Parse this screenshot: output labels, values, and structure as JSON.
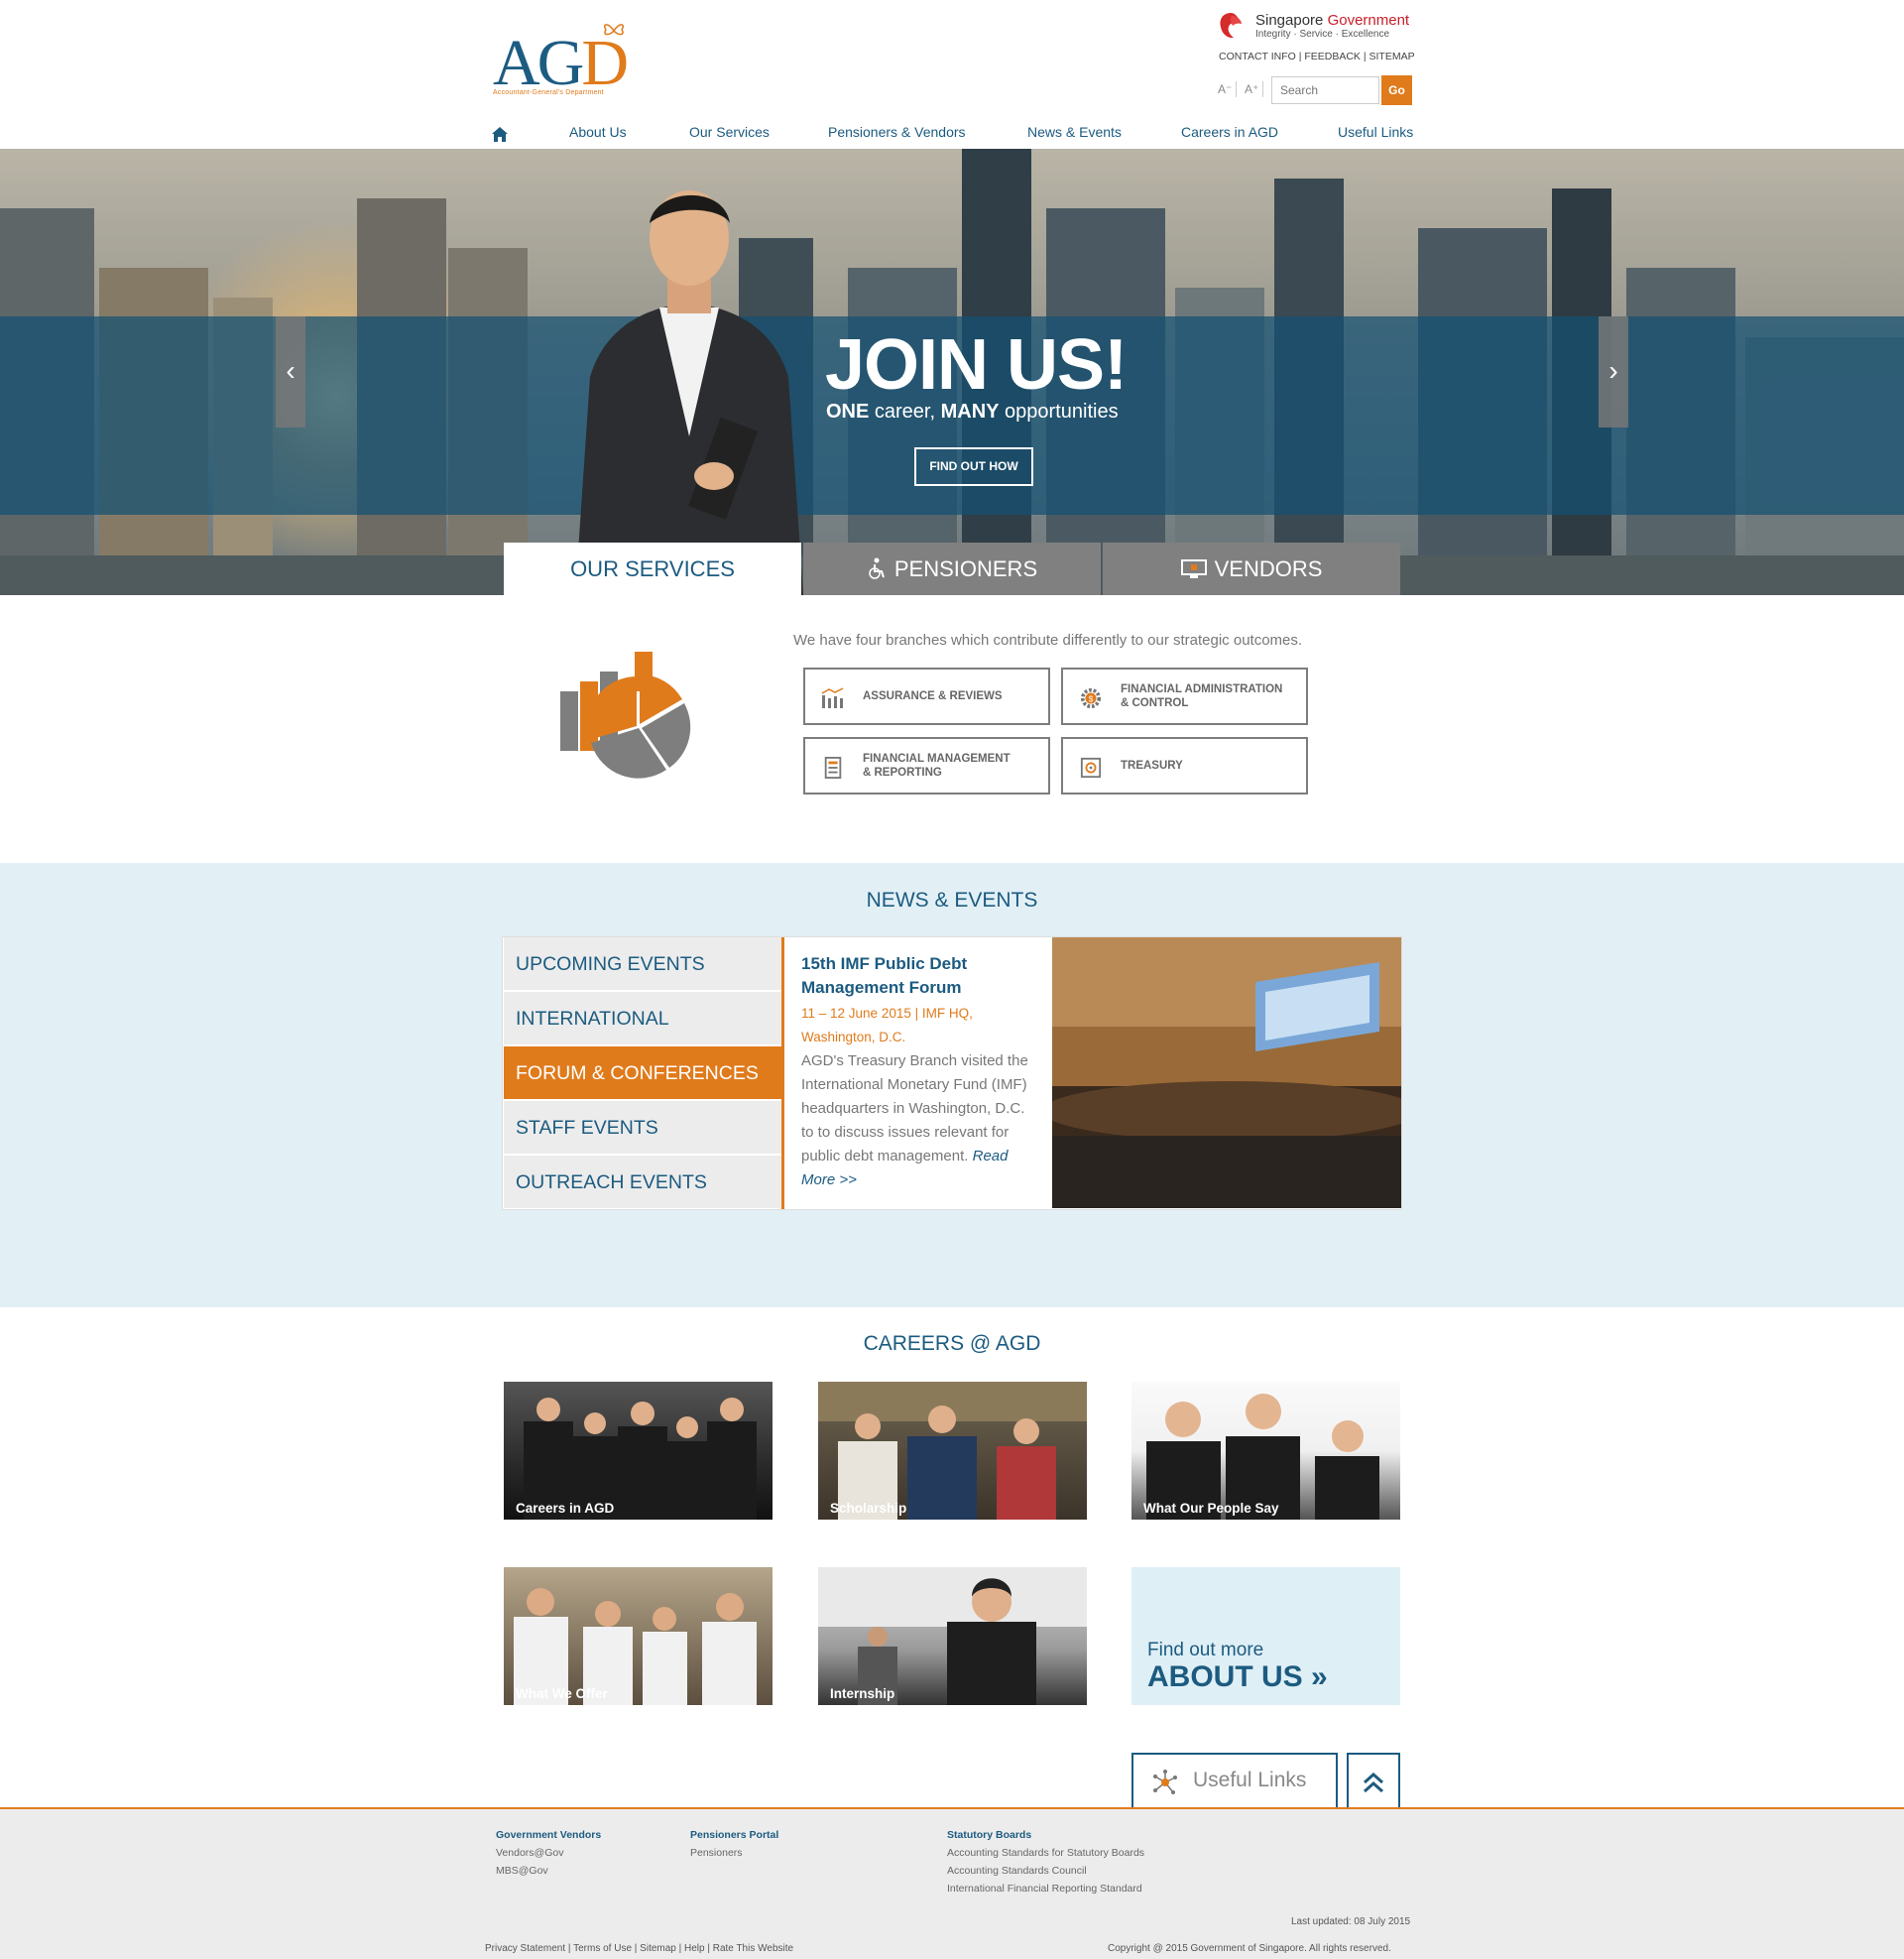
{
  "header": {
    "logo_letters_a": "AG",
    "logo_letters_d": "D",
    "logo_subtitle": "Accountant-General's Department",
    "sg_gov_name_a": "Singapore ",
    "sg_gov_name_b": "Government",
    "sg_gov_tagline": "Integrity · Service · Excellence",
    "utility_links": [
      "CONTACT INFO",
      "FEEDBACK",
      "SITEMAP"
    ],
    "font_decrease": "A⁻",
    "font_increase": "A⁺",
    "search_placeholder": "Search",
    "search_button": "Go"
  },
  "nav": {
    "items": [
      "About Us",
      "Our Services",
      "Pensioners & Vendors",
      "News & Events",
      "Careers in AGD",
      "Useful Links"
    ]
  },
  "hero": {
    "headline": "JOIN US!",
    "sub_one": "ONE",
    "sub_mid": " career, ",
    "sub_many": "MANY",
    "sub_end": " opportunities",
    "cta": "FIND OUT HOW",
    "prev_icon": "chevron-left-icon",
    "next_icon": "chevron-right-icon"
  },
  "tabs": [
    {
      "label": "OUR SERVICES",
      "active": true
    },
    {
      "label": "PENSIONERS",
      "active": false,
      "icon": "wheelchair-icon"
    },
    {
      "label": "VENDORS",
      "active": false,
      "icon": "monitor-icon"
    }
  ],
  "services": {
    "intro": "We have four branches which contribute differently to our strategic outcomes.",
    "branches": [
      {
        "line1": "ASSURANCE & REVIEWS",
        "line2": "",
        "icon": "bar-chart-icon"
      },
      {
        "line1": "FINANCIAL ADMINISTRATION",
        "line2": "& CONTROL",
        "icon": "gear-dollar-icon"
      },
      {
        "line1": "FINANCIAL MANAGEMENT",
        "line2": "& REPORTING",
        "icon": "ledger-icon"
      },
      {
        "line1": "TREASURY",
        "line2": "",
        "icon": "safe-icon"
      }
    ]
  },
  "news": {
    "title": "NEWS & EVENTS",
    "categories": [
      "UPCOMING EVENTS",
      "INTERNATIONAL RELATIONS",
      "FORUM & CONFERENCES",
      "STAFF EVENTS",
      "OUTREACH EVENTS"
    ],
    "selected_category": "FORUM & CONFERENCES",
    "event": {
      "title": "15th IMF Public Debt Management Forum",
      "meta": "11 – 12 June 2015 | IMF HQ, Washington, D.C.",
      "body": "AGD's Treasury Branch visited the International Monetary Fund (IMF) headquarters in Washington, D.C. to to discuss issues relevant for public debt management. ",
      "read_more": "Read More >>"
    }
  },
  "careers": {
    "title": "CAREERS @ AGD",
    "cards": [
      "Careers in AGD",
      "Scholarship",
      "What Our People Say",
      "What We Offer",
      "Internship"
    ],
    "about_line1": "Find out more",
    "about_line2": "ABOUT US »",
    "useful_links": "Useful Links"
  },
  "footer": {
    "col1_head": "Government Vendors",
    "col1_links": [
      "Vendors@Gov",
      "MBS@Gov"
    ],
    "col2_head": "Pensioners Portal",
    "col2_links": [
      "Pensioners"
    ],
    "col3_head": "Statutory Boards",
    "col3_links": [
      "Accounting Standards for Statutory Boards",
      "Accounting Standards Council",
      "International Financial Reporting Standard"
    ],
    "last_updated": "Last updated: 08 July 2015",
    "bottom_links": "Privacy Statement | Terms of Use | Sitemap | Help | Rate This Website",
    "copyright": "Copyright @ 2015 Government of Singapore. All rights reserved."
  },
  "colors": {
    "brand_blue": "#1c5b80",
    "brand_orange": "#e07b1c",
    "news_bg": "#e2f0f6",
    "footer_bg": "#ececec"
  }
}
